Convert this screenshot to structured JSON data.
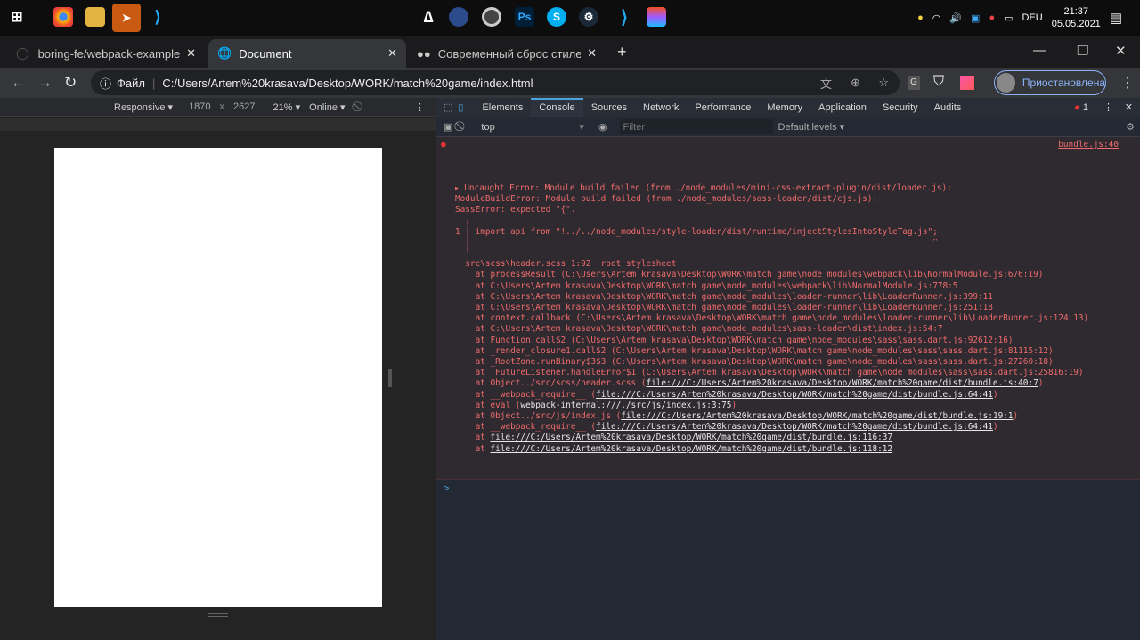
{
  "taskbar": {
    "left_icons": [
      "windows-icon",
      "chrome-icon",
      "file-explorer-icon",
      "telegram-icon",
      "vscode-icon"
    ],
    "center_icons": [
      "assassins-creed-icon",
      "cinema4d-icon",
      "obs-icon",
      "photoshop-icon",
      "skype-icon",
      "steam-icon",
      "vscode-icon",
      "figma-icon"
    ],
    "language": "DEU",
    "time": "21:37",
    "date": "05.05.2021"
  },
  "browser": {
    "tabs": [
      {
        "title": "boring-fe/webpack-example"
      },
      {
        "title": "Document"
      },
      {
        "title": "Современный сброс стилей CSS"
      }
    ],
    "address_prefix": "Файл",
    "url": "C:/Users/Artem%20krasava/Desktop/WORK/match%20game/index.html",
    "profile_label": "Приостановлена",
    "extension_g": "G"
  },
  "device_toolbar": {
    "device": "Responsive",
    "width": "1870",
    "x": "x",
    "height": "2627",
    "zoom": "21%",
    "throttle": "Online"
  },
  "devtools": {
    "tabs": [
      "Elements",
      "Console",
      "Sources",
      "Network",
      "Performance",
      "Memory",
      "Application",
      "Security",
      "Audits"
    ],
    "active_tab": "Console",
    "error_count": "1",
    "context": "top",
    "filter_placeholder": "Filter",
    "levels": "Default levels",
    "error": {
      "source": "bundle.js:40",
      "lines": [
        "Uncaught Error: Module build failed (from ./node_modules/mini-css-extract-plugin/dist/loader.js):",
        "ModuleBuildError: Module build failed (from ./node_modules/sass-loader/dist/cjs.js):",
        "SassError: expected \"{\".",
        "",
        "  ╷",
        "1 │ import api from \"!../../node_modules/style-loader/dist/runtime/injectStylesIntoStyleTag.js\";",
        "  │                                                                                            ^",
        "  ╵",
        "  src\\scss\\header.scss 1:92  root stylesheet",
        "    at processResult (C:\\Users\\Artem krasava\\Desktop\\WORK\\match game\\node_modules\\webpack\\lib\\NormalModule.js:676:19)",
        "    at C:\\Users\\Artem krasava\\Desktop\\WORK\\match game\\node_modules\\webpack\\lib\\NormalModule.js:778:5",
        "    at C:\\Users\\Artem krasava\\Desktop\\WORK\\match game\\node_modules\\loader-runner\\lib\\LoaderRunner.js:399:11",
        "    at C:\\Users\\Artem krasava\\Desktop\\WORK\\match game\\node_modules\\loader-runner\\lib\\LoaderRunner.js:251:18",
        "    at context.callback (C:\\Users\\Artem krasava\\Desktop\\WORK\\match game\\node_modules\\loader-runner\\lib\\LoaderRunner.js:124:13)",
        "    at C:\\Users\\Artem krasava\\Desktop\\WORK\\match game\\node_modules\\sass-loader\\dist\\index.js:54:7",
        "    at Function.call$2 (C:\\Users\\Artem krasava\\Desktop\\WORK\\match game\\node_modules\\sass\\sass.dart.js:92612:16)",
        "    at _render_closure1.call$2 (C:\\Users\\Artem krasava\\Desktop\\WORK\\match game\\node_modules\\sass\\sass.dart.js:81115:12)",
        "    at _RootZone.runBinary$3$3 (C:\\Users\\Artem krasava\\Desktop\\WORK\\match game\\node_modules\\sass\\sass.dart.js:27260:18)",
        "    at _FutureListener.handleError$1 (C:\\Users\\Artem krasava\\Desktop\\WORK\\match game\\node_modules\\sass\\sass.dart.js:25816:19)"
      ],
      "link_lines": [
        {
          "prefix": "    at Object../src/scss/header.scss (",
          "link": "file:///C:/Users/Artem%20krasava/Desktop/WORK/match%20game/dist/bundle.js:40:7",
          "suffix": ")"
        },
        {
          "prefix": "    at __webpack_require__ (",
          "link": "file:///C:/Users/Artem%20krasava/Desktop/WORK/match%20game/dist/bundle.js:64:41",
          "suffix": ")"
        },
        {
          "prefix": "    at eval (",
          "link": "webpack-internal:///./src/js/index.js:3:75",
          "suffix": ")"
        },
        {
          "prefix": "    at Object../src/js/index.js (",
          "link": "file:///C:/Users/Artem%20krasava/Desktop/WORK/match%20game/dist/bundle.js:19:1",
          "suffix": ")"
        },
        {
          "prefix": "    at __webpack_require__ (",
          "link": "file:///C:/Users/Artem%20krasava/Desktop/WORK/match%20game/dist/bundle.js:64:41",
          "suffix": ")"
        },
        {
          "prefix": "    at ",
          "link": "file:///C:/Users/Artem%20krasava/Desktop/WORK/match%20game/dist/bundle.js:116:37",
          "suffix": ""
        },
        {
          "prefix": "    at ",
          "link": "file:///C:/Users/Artem%20krasava/Desktop/WORK/match%20game/dist/bundle.js:118:12",
          "suffix": ""
        }
      ]
    },
    "prompt": ">"
  }
}
